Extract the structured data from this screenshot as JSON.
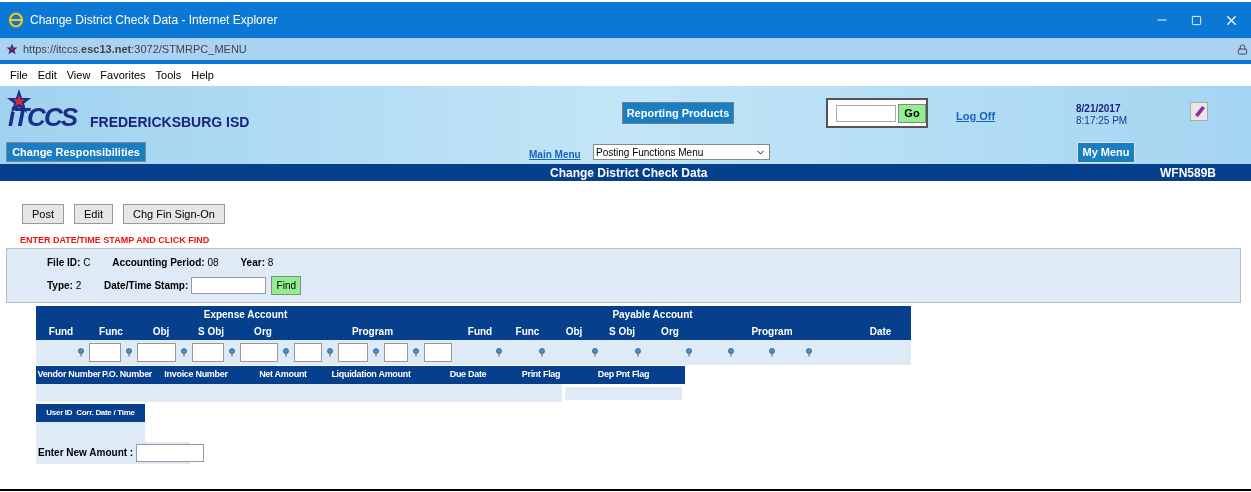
{
  "window": {
    "title": "Change District Check Data - Internet Explorer"
  },
  "address_bar": {
    "url": "https://itccs.**esc13.net**:3072/STMRPC_MENU"
  },
  "menu_bar": [
    "File",
    "Edit",
    "View",
    "Favorites",
    "Tools",
    "Help"
  ],
  "header": {
    "logo": "iTCCS",
    "district": "FREDERICKSBURG ISD",
    "change_responsibilities": "Change Responsibilities",
    "reporting_products": "Reporting Products",
    "go_button": "Go",
    "log_off": "Log Off",
    "date": "8/21/2017",
    "time": "8:17:25 PM",
    "main_menu": "Main Menu",
    "menu_select": "Posting Functions Menu",
    "my_menu": "My Menu"
  },
  "page_title_bar": {
    "title": "Change District Check Data",
    "code": "WFN589B"
  },
  "action_buttons": [
    "Post",
    "Edit",
    "Chg Fin Sign-On"
  ],
  "message": "ENTER DATE/TIME STAMP AND CLICK FIND",
  "filter_panel": {
    "file_id": {
      "label": "File ID:",
      "value": "C"
    },
    "accounting_period": {
      "label": "Accounting Period:",
      "value": "08"
    },
    "year": {
      "label": "Year:",
      "value": "8"
    },
    "type": {
      "label": "Type:",
      "value": "2"
    },
    "date_time_stamp": {
      "label": "Date/Time Stamp:"
    },
    "find_button": "Find"
  },
  "account_table": {
    "groups": [
      "Expense Account",
      "Payable Account"
    ],
    "columns": [
      "Fund",
      "Func",
      "Obj",
      "S Obj",
      "Org",
      "Program",
      "Fund",
      "Func",
      "Obj",
      "S Obj",
      "Org",
      "Program",
      "Date"
    ]
  },
  "invoice_table": {
    "columns": [
      "Vendor Number",
      "P.O. Number",
      "Invoice Number",
      "Net Amount",
      "Liquidation Amount",
      "Due Date",
      "Print Flag",
      "Dep Pnt Flag"
    ]
  },
  "audit_table": {
    "columns": [
      "User ID",
      "Corr. Date / Time"
    ]
  },
  "new_amount": {
    "label": "Enter New Amount :"
  }
}
